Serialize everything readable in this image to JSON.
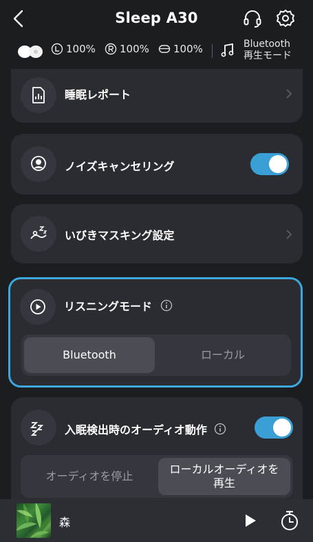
{
  "header": {
    "title": "Sleep A30"
  },
  "status": {
    "left_battery": "100%",
    "right_battery": "100%",
    "case_battery": "100%",
    "mode_line1": "Bluetooth",
    "mode_line2": "再生モード"
  },
  "menu": {
    "sleep_report": "睡眠レポート",
    "noise_cancel": "ノイズキャンセリング",
    "noise_cancel_on": true,
    "snore_masking": "いびきマスキング設定"
  },
  "listening": {
    "title": "リスニングモード",
    "options": [
      "Bluetooth",
      "ローカル"
    ],
    "selected": "Bluetooth",
    "highlight_color": "#3ca8dd"
  },
  "sleep_detect": {
    "title": "入眠検出時のオーディオ動作",
    "enabled": true,
    "option_stop": "オーディオを停止",
    "option_play_line1": "ローカルオーディオを",
    "option_play_line2": "再生"
  },
  "player": {
    "track": "森"
  },
  "colors": {
    "accent": "#3a9fd5",
    "card": "#2a2c31",
    "background": "#1b1d21"
  }
}
